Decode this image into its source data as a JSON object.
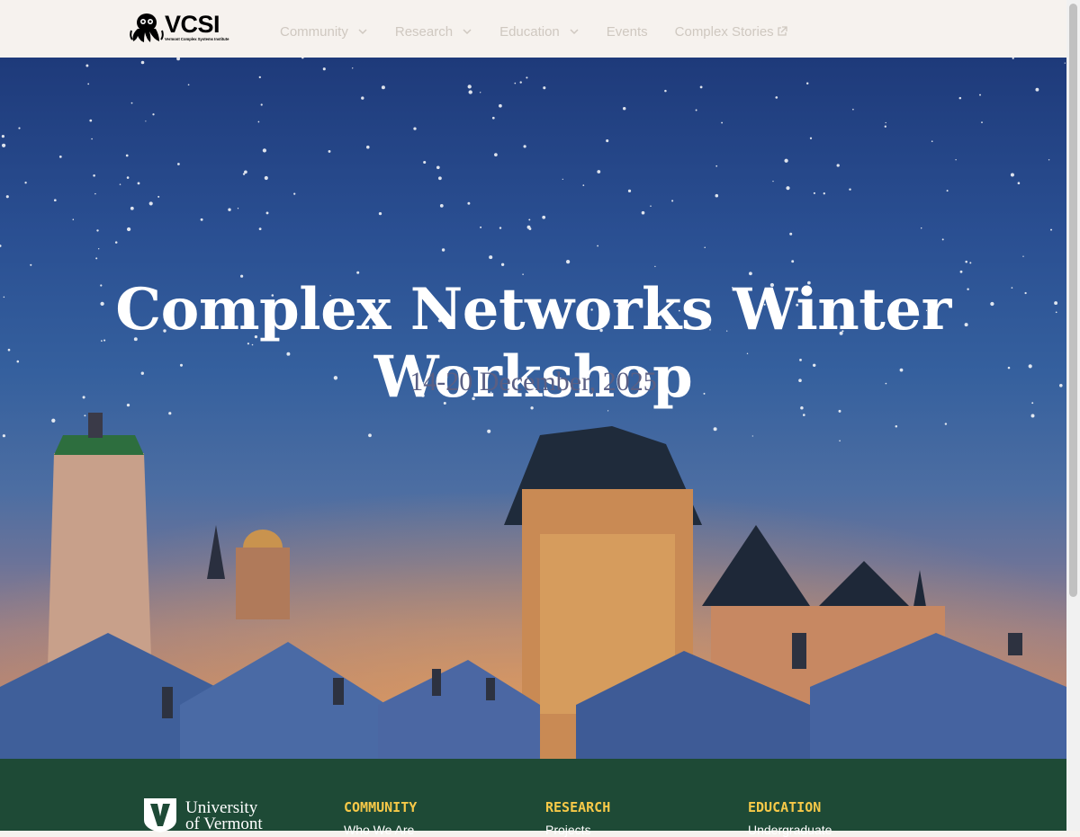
{
  "header": {
    "logo": {
      "wordmark": "VCSI",
      "tagline": "Vermont Complex Systems Institute"
    },
    "nav": [
      {
        "label": "Community",
        "dropdown": true
      },
      {
        "label": "Research",
        "dropdown": true
      },
      {
        "label": "Education",
        "dropdown": true
      },
      {
        "label": "Events",
        "dropdown": false
      },
      {
        "label": "Complex Stories",
        "external": true
      }
    ]
  },
  "hero": {
    "title": "Complex Networks Winter Workshop",
    "date": "14-20 December, 2025"
  },
  "footer": {
    "university": {
      "line1": "University",
      "line2": "of Vermont"
    },
    "columns": [
      {
        "heading": "COMMUNITY",
        "first_link": "Who We Are"
      },
      {
        "heading": "RESEARCH",
        "first_link": "Projects"
      },
      {
        "heading": "EDUCATION",
        "first_link": "Undergraduate"
      }
    ]
  },
  "colors": {
    "nav_text": "#cfc8c0",
    "footer_bg": "#1e4a36",
    "footer_heading": "#f7c948",
    "topbar_bg": "#f6f2ee"
  }
}
